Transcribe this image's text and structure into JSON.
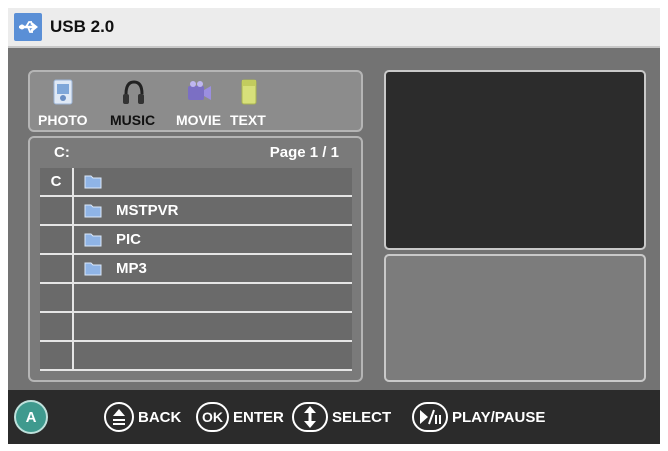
{
  "title": "USB 2.0",
  "media_tabs": [
    {
      "label": "PHOTO",
      "icon": "photo-icon",
      "active": false
    },
    {
      "label": "MUSIC",
      "icon": "music-icon",
      "active": true
    },
    {
      "label": "MOVIE",
      "icon": "movie-icon",
      "active": false
    },
    {
      "label": "TEXT",
      "icon": "text-icon",
      "active": false
    }
  ],
  "browser": {
    "drive": "C:",
    "page": "Page 1 / 1",
    "rows": [
      {
        "col": "C",
        "folder": true,
        "name": ""
      },
      {
        "col": "",
        "folder": true,
        "name": "MSTPVR"
      },
      {
        "col": "",
        "folder": true,
        "name": "PIC"
      },
      {
        "col": "",
        "folder": true,
        "name": "MP3"
      },
      {
        "col": "",
        "folder": false,
        "name": ""
      },
      {
        "col": "",
        "folder": false,
        "name": ""
      },
      {
        "col": "",
        "folder": false,
        "name": ""
      }
    ]
  },
  "footer": {
    "logo": "A",
    "hints": [
      {
        "key": "up-down-icon",
        "label": "BACK"
      },
      {
        "key": "OK",
        "label": "ENTER"
      },
      {
        "key": "arrows-icon",
        "label": "SELECT"
      },
      {
        "key": "play-pause-icon",
        "label": "PLAY/PAUSE"
      }
    ]
  },
  "colors": {
    "screen": "#737373",
    "accent": "#5a8fd6",
    "footer": "#2b2b2b"
  }
}
